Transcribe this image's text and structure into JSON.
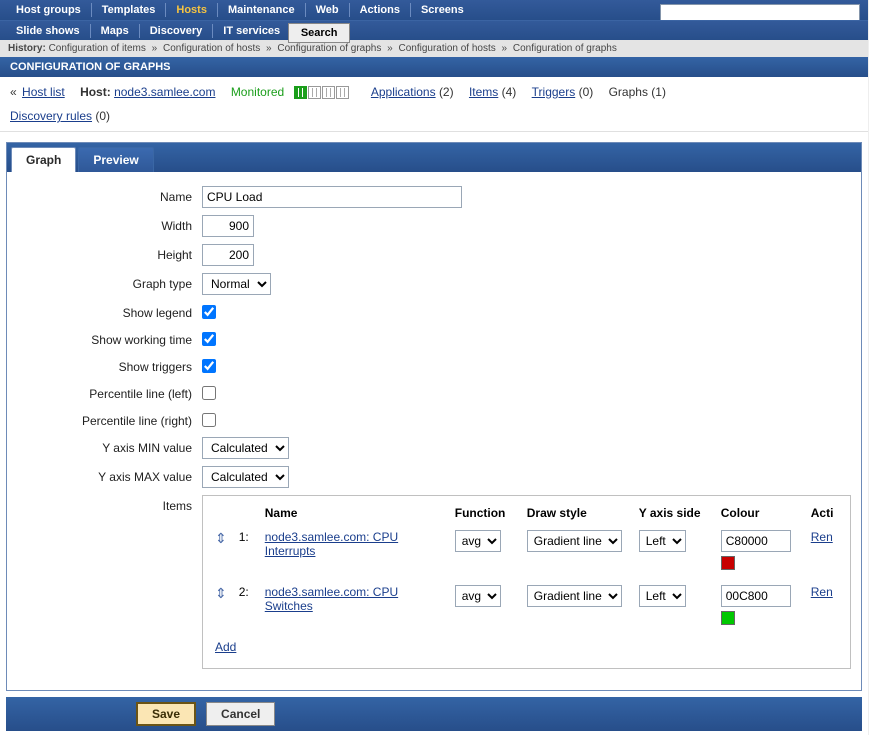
{
  "nav": {
    "row1": [
      "Host groups",
      "Templates",
      "Hosts",
      "Maintenance",
      "Web",
      "Actions",
      "Screens"
    ],
    "row2": [
      "Slide shows",
      "Maps",
      "Discovery",
      "IT services"
    ],
    "active": "Hosts",
    "search_btn": "Search"
  },
  "history": {
    "label": "History:",
    "items": [
      "Configuration of items",
      "Configuration of hosts",
      "Configuration of graphs",
      "Configuration of hosts",
      "Configuration of graphs"
    ]
  },
  "section_title": "CONFIGURATION OF GRAPHS",
  "hostbar": {
    "hostlist": "Host list",
    "host_label": "Host:",
    "host_name": "node3.samlee.com",
    "monitored": "Monitored",
    "applications_label": "Applications",
    "applications_count": "(2)",
    "items_label": "Items",
    "items_count": "(4)",
    "triggers_label": "Triggers",
    "triggers_count": "(0)",
    "graphs_label": "Graphs",
    "graphs_count": "(1)",
    "discovery_label": "Discovery rules",
    "discovery_count": "(0)"
  },
  "tabs": {
    "graph": "Graph",
    "preview": "Preview"
  },
  "form": {
    "name_label": "Name",
    "name_value": "CPU Load",
    "width_label": "Width",
    "width_value": "900",
    "height_label": "Height",
    "height_value": "200",
    "gtype_label": "Graph type",
    "gtype_value": "Normal",
    "legend_label": "Show legend",
    "legend_checked": true,
    "worktime_label": "Show working time",
    "worktime_checked": true,
    "triggers_label": "Show triggers",
    "triggers_checked": true,
    "pleft_label": "Percentile line (left)",
    "pleft_checked": false,
    "pright_label": "Percentile line (right)",
    "pright_checked": false,
    "ymin_label": "Y axis MIN value",
    "ymin_value": "Calculated",
    "ymax_label": "Y axis MAX value",
    "ymax_value": "Calculated",
    "items_label": "Items"
  },
  "items_table": {
    "headers": {
      "name": "Name",
      "function": "Function",
      "drawstyle": "Draw style",
      "yaxis": "Y axis side",
      "colour": "Colour",
      "action": "Acti"
    },
    "rows": [
      {
        "index": "1:",
        "name": "node3.samlee.com: CPU Interrupts",
        "function": "avg",
        "drawstyle": "Gradient line",
        "yaxis": "Left",
        "colour": "C80000",
        "action": "Ren"
      },
      {
        "index": "2:",
        "name": "node3.samlee.com: CPU Switches",
        "function": "avg",
        "drawstyle": "Gradient line",
        "yaxis": "Left",
        "colour": "00C800",
        "action": "Ren"
      }
    ],
    "add": "Add"
  },
  "footer": {
    "save": "Save",
    "cancel": "Cancel"
  },
  "colors": {
    "swatch1": "#c80000",
    "swatch2": "#00c800"
  }
}
